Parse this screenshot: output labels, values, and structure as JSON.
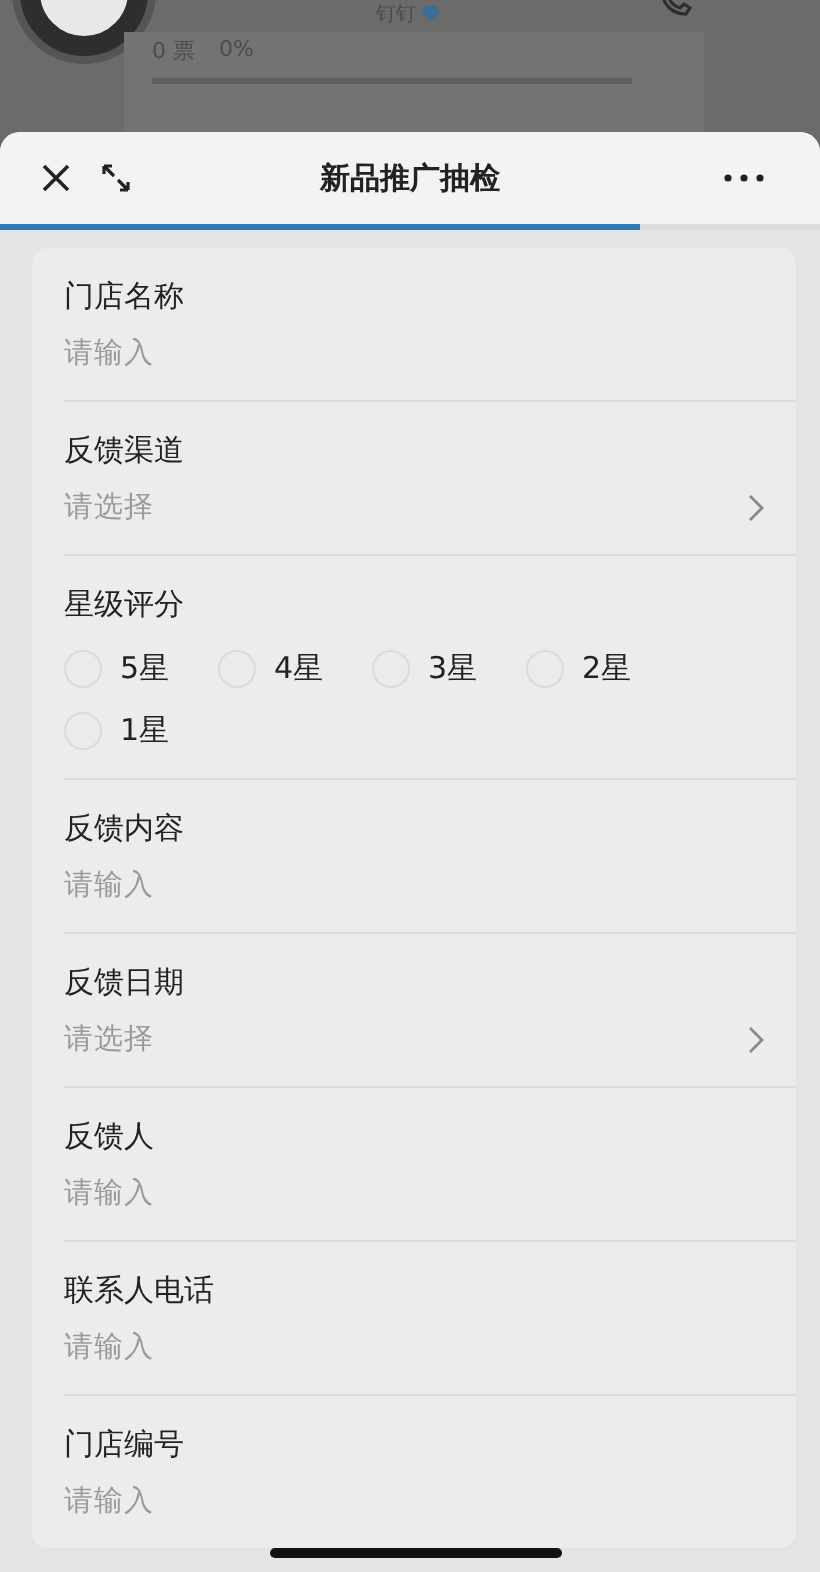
{
  "background": {
    "app_name": "钉钉",
    "votes": "0 票",
    "percent": "0%"
  },
  "sheet": {
    "title": "新品推广抽检",
    "level": 0.78
  },
  "fields": [
    {
      "kind": "input",
      "label": "门店名称",
      "placeholder": "请输入"
    },
    {
      "kind": "select",
      "label": "反馈渠道",
      "placeholder": "请选择"
    },
    {
      "kind": "radio",
      "label": "星级评分",
      "options": [
        {
          "label": "5星",
          "selected": false
        },
        {
          "label": "4星",
          "selected": false
        },
        {
          "label": "3星",
          "selected": false
        },
        {
          "label": "2星",
          "selected": false
        },
        {
          "label": "1星",
          "selected": false
        }
      ]
    },
    {
      "kind": "input",
      "label": "反馈内容",
      "placeholder": "请输入"
    },
    {
      "kind": "select",
      "label": "反馈日期",
      "placeholder": "请选择"
    },
    {
      "kind": "input",
      "label": "反馈人",
      "placeholder": "请输入"
    },
    {
      "kind": "input",
      "label": "联系人电话",
      "placeholder": "请输入"
    },
    {
      "kind": "input",
      "label": "门店编号",
      "placeholder": "请输入"
    }
  ]
}
